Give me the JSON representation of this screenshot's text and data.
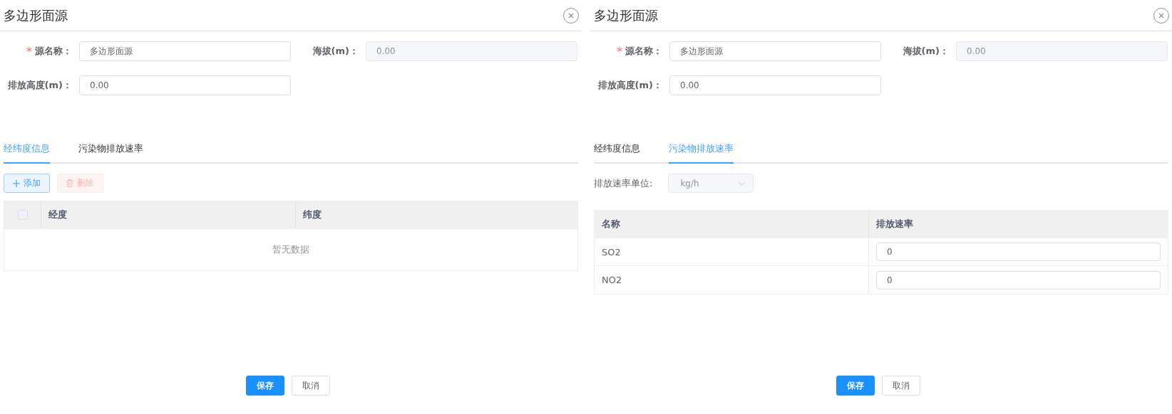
{
  "panels": [
    {
      "title": "多边形面源",
      "fields": [
        {
          "label": "源名称：",
          "required_mark": "*",
          "value": "多边形面源",
          "disabled": false
        },
        {
          "label": "海拔(m)：",
          "value": "0.00",
          "disabled": true
        },
        {
          "label": "排放高度(m)：",
          "value": "0.00",
          "disabled": false
        }
      ],
      "tabs": [
        {
          "label": "经纬度信息",
          "selected": true
        },
        {
          "label": "污染物排放速率",
          "selected": false
        }
      ],
      "content": {
        "kind": "coordinates",
        "buttons": [
          {
            "kind": "add",
            "label": "添加",
            "disabled": false
          },
          {
            "kind": "delete",
            "label": "删除",
            "disabled": true
          }
        ],
        "select_all": {
          "checked": false
        },
        "columns": [
          "经度",
          "纬度"
        ],
        "empty_text": "暂无数据"
      },
      "footer": [
        {
          "kind": "primary",
          "label": "保存"
        },
        {
          "kind": "default",
          "label": "取消"
        }
      ]
    },
    {
      "title": "多边形面源",
      "fields": [
        {
          "label": "源名称：",
          "required_mark": "*",
          "value": "多边形面源",
          "disabled": false
        },
        {
          "label": "海拔(m)：",
          "value": "0.00",
          "disabled": true
        },
        {
          "label": "排放高度(m)：",
          "value": "0.00",
          "disabled": false
        }
      ],
      "tabs": [
        {
          "label": "经纬度信息",
          "selected": false
        },
        {
          "label": "污染物排放速率",
          "selected": true
        }
      ],
      "content": {
        "kind": "emission",
        "unit": {
          "label": "排放速率单位:",
          "value": "kg/h",
          "disabled": true
        },
        "columns": [
          "名称",
          "排放速率"
        ],
        "rows": [
          {
            "name": "SO2",
            "rate": "0"
          },
          {
            "name": "NO2",
            "rate": "0"
          }
        ]
      },
      "footer": [
        {
          "kind": "primary",
          "label": "保存"
        },
        {
          "kind": "default",
          "label": "取消"
        }
      ]
    }
  ]
}
